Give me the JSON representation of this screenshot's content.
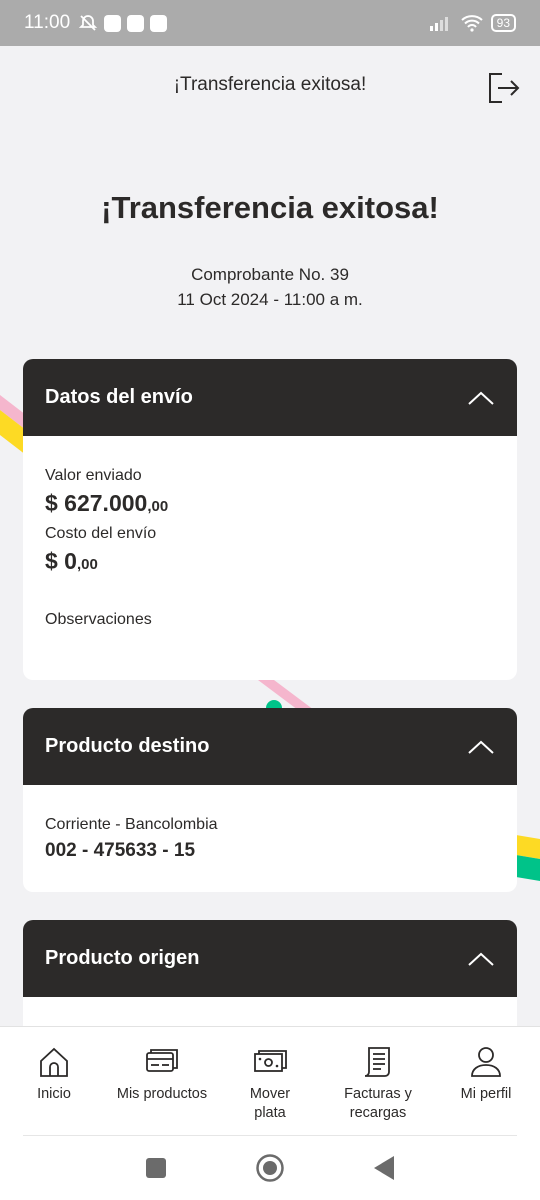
{
  "status_bar": {
    "time": "11:00",
    "battery": "93",
    "icons": [
      "mute-icon",
      "messenger-app-icon",
      "contacts-app-icon",
      "phone-app-icon",
      "signal-icon",
      "wifi-icon",
      "battery-icon"
    ]
  },
  "header": {
    "title": "¡Transferencia exitosa!",
    "exit_icon": "exit-icon"
  },
  "hero": {
    "title": "¡Transferencia exitosa!",
    "receipt_number": "Comprobante No. 39",
    "datetime": "11 Oct 2024 - 11:00 a m."
  },
  "cards": {
    "envio": {
      "title": "Datos del envío",
      "valor_label": "Valor enviado",
      "valor_int": "$ 627.000",
      "valor_dec": ",00",
      "costo_label": "Costo del envío",
      "costo_int": "$ 0",
      "costo_dec": ",00",
      "observaciones_label": "Observaciones"
    },
    "destino": {
      "title": "Producto destino",
      "account_type": "Corriente - Bancolombia",
      "account_number": "002 - 475633 - 15"
    },
    "origen": {
      "title": "Producto origen"
    }
  },
  "bottom_nav": {
    "items": [
      {
        "label": "Inicio",
        "icon": "home-icon"
      },
      {
        "label": "Mis productos",
        "icon": "cards-icon"
      },
      {
        "label": "Mover plata",
        "icon": "money-icon"
      },
      {
        "label": "Facturas y recargas",
        "icon": "bill-icon"
      },
      {
        "label": "Mi perfil",
        "icon": "user-icon"
      }
    ]
  },
  "colors": {
    "dark": "#2c2a29",
    "background": "#f2f2f4",
    "accent_yellow": "#fdda24",
    "accent_pink": "#f5b6cd",
    "accent_green": "#00c389"
  }
}
